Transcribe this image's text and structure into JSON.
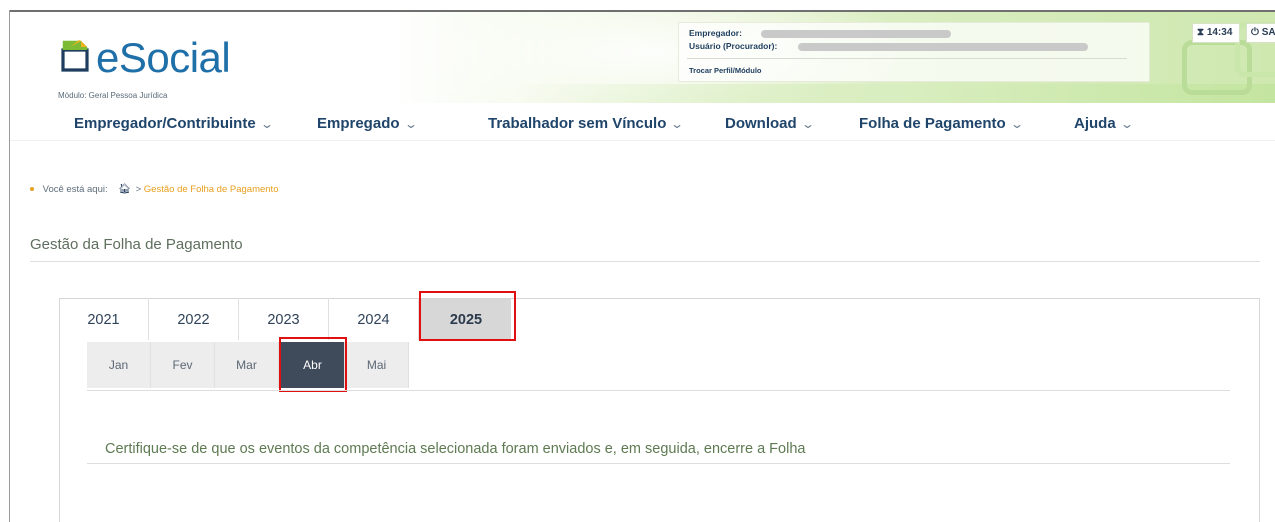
{
  "header": {
    "logo_text": "eSocial",
    "modulo": "Módulo: Geral Pessoa Jurídica",
    "empregador_label": "Empregador:",
    "usuario_label": "Usuário (Procurador):",
    "trocar_perfil": "Trocar Perfil/Módulo",
    "time": "14:34",
    "sair": "SAIR",
    "accent_color": "#1f6fa8"
  },
  "nav": {
    "items": [
      {
        "label": "Empregador/Contribuinte"
      },
      {
        "label": "Empregado"
      },
      {
        "label": "Trabalhador sem Vínculo"
      },
      {
        "label": "Download"
      },
      {
        "label": "Folha de Pagamento"
      },
      {
        "label": "Ajuda"
      }
    ],
    "chevron": "⌄"
  },
  "breadcrumb": {
    "prefix": "Você está aqui:",
    "home_icon": "home-icon",
    "separator": ">",
    "current": "Gestão de Folha de Pagamento"
  },
  "page_title": "Gestão da Folha de Pagamento",
  "years": {
    "items": [
      "2021",
      "2022",
      "2023",
      "2024",
      "2025"
    ],
    "selected": "2025"
  },
  "months": {
    "items": [
      "Jan",
      "Fev",
      "Mar",
      "Abr",
      "Mai"
    ],
    "selected": "Abr"
  },
  "info_text": "Certifique-se de que os eventos da competência selecionada foram enviados e, em seguida, encerre a Folha",
  "highlight_color": "#e01010"
}
